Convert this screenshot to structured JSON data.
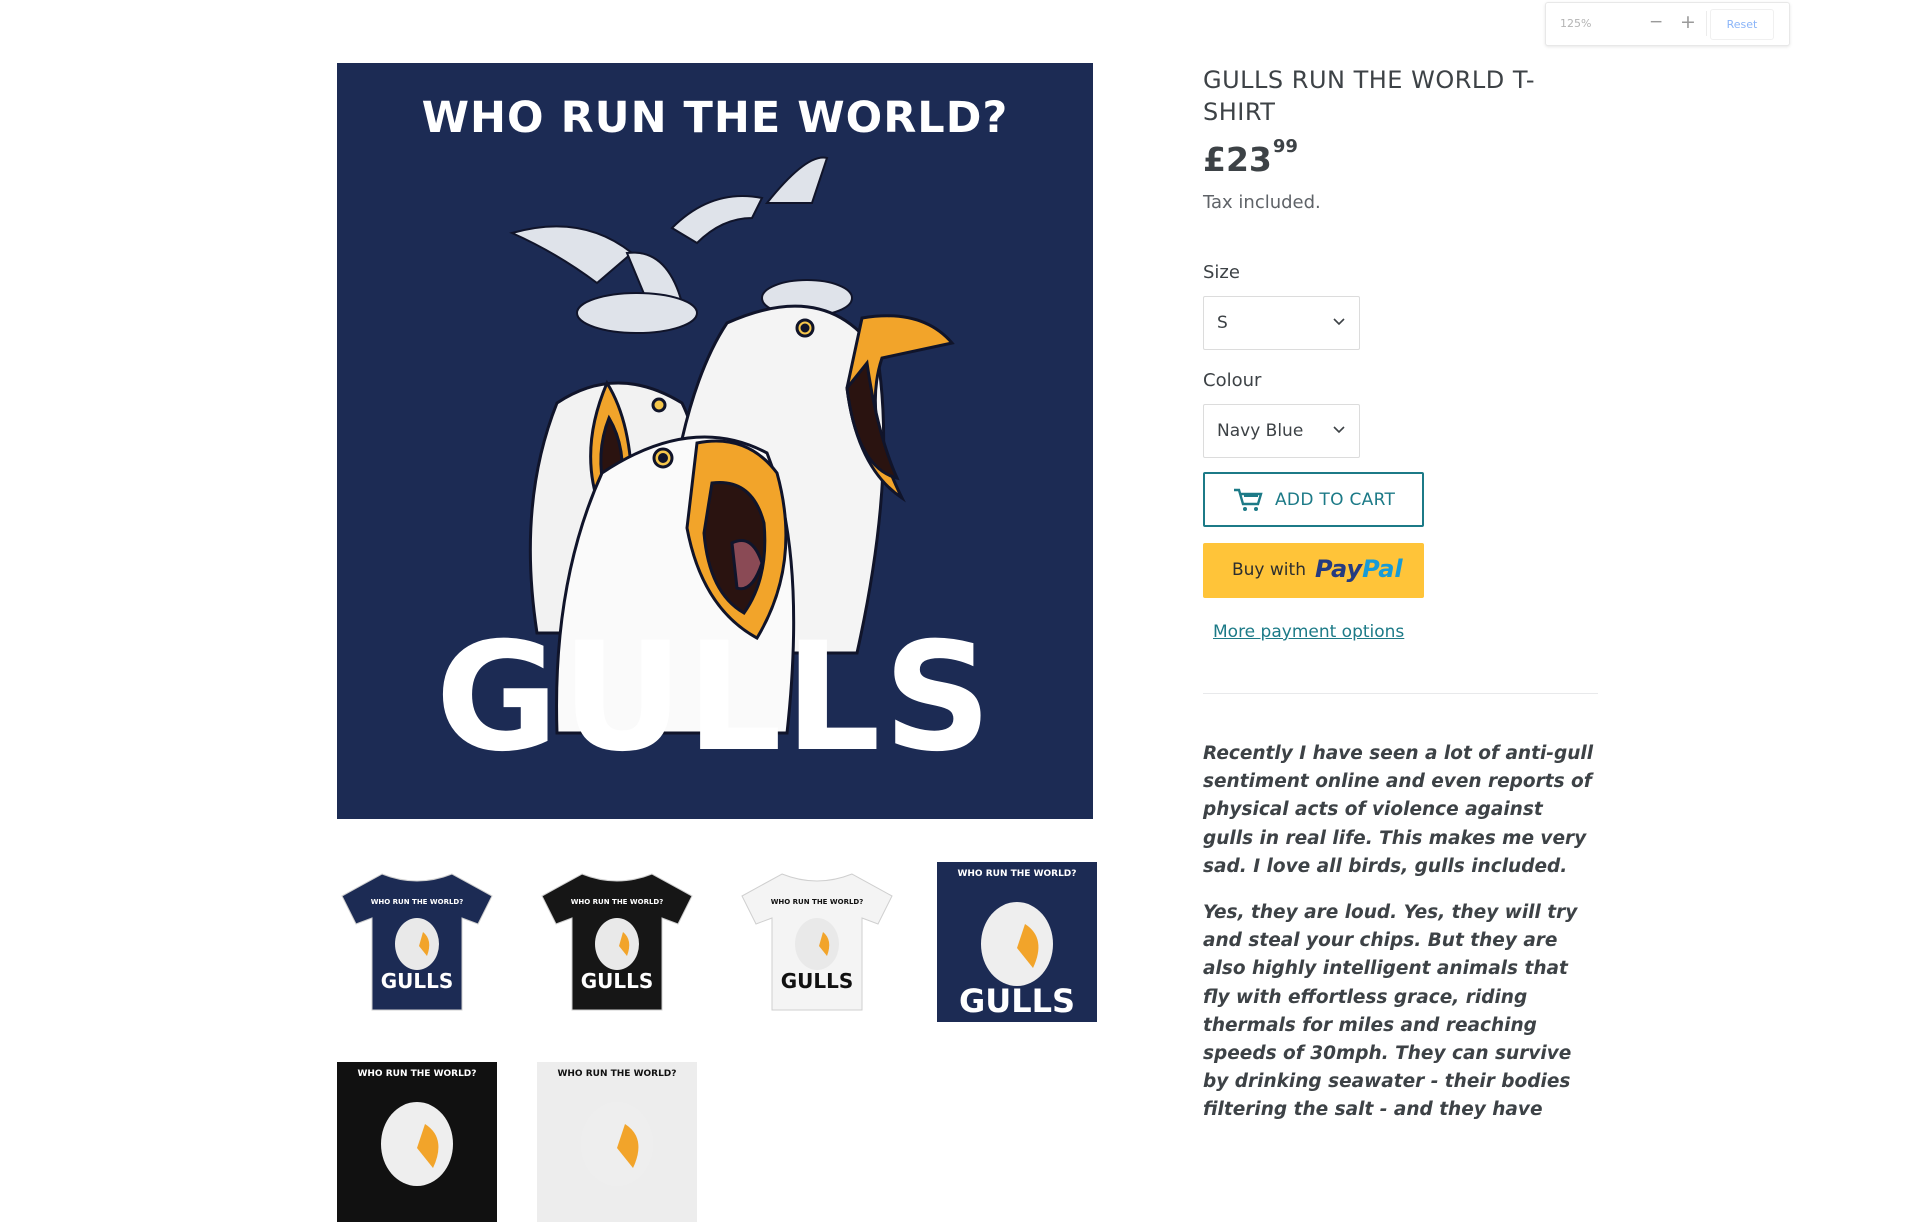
{
  "zoom": {
    "level": "125%",
    "minus": "−",
    "plus": "+",
    "reset": "Reset"
  },
  "product": {
    "title": "GULLS RUN THE WORLD T-SHIRT",
    "price_main": "£23",
    "price_cents": "99",
    "tax": "Tax included.",
    "size_label": "Size",
    "size_value": "S",
    "colour_label": "Colour",
    "colour_value": "Navy Blue",
    "add_to_cart": "ADD TO CART",
    "buy_with": "Buy with",
    "paypal_1": "Pay",
    "paypal_2": "Pal",
    "more_payment": "More payment options",
    "description": [
      "Recently I have seen a lot of anti-gull sentiment online and even reports of physical acts of violence against gulls in real life. This makes me very sad. I love all birds, gulls included.",
      "Yes, they are loud. Yes, they will try and steal your chips. But they are also highly intelligent animals that fly with effortless grace, riding thermals for miles and reaching speeds of 30mph. They can survive by drinking seawater - their bodies filtering the salt - and they have"
    ]
  },
  "artwork": {
    "top_text": "WHO RUN THE WORLD?",
    "big_text": "GULLS"
  },
  "thumbnails": [
    {
      "kind": "shirt",
      "color": "#1c2b54",
      "small_text": "WHO RUN THE WORLD?",
      "big_text": "GULLS"
    },
    {
      "kind": "shirt",
      "color": "#161616",
      "small_text": "WHO RUN THE WORLD?",
      "big_text": "GULLS"
    },
    {
      "kind": "shirt",
      "color": "#f4f4f4",
      "small_text": "WHO RUN THE WORLD?",
      "big_text": "GULLS"
    },
    {
      "kind": "print",
      "color": "#1c2b54",
      "small_text": "WHO RUN THE WORLD?",
      "big_text": "GULLS"
    },
    {
      "kind": "print",
      "color": "#111111",
      "small_text": "WHO RUN THE WORLD?",
      "big_text": ""
    },
    {
      "kind": "print",
      "color": "#ededed",
      "small_text": "WHO RUN THE WORLD?",
      "big_text": ""
    }
  ]
}
